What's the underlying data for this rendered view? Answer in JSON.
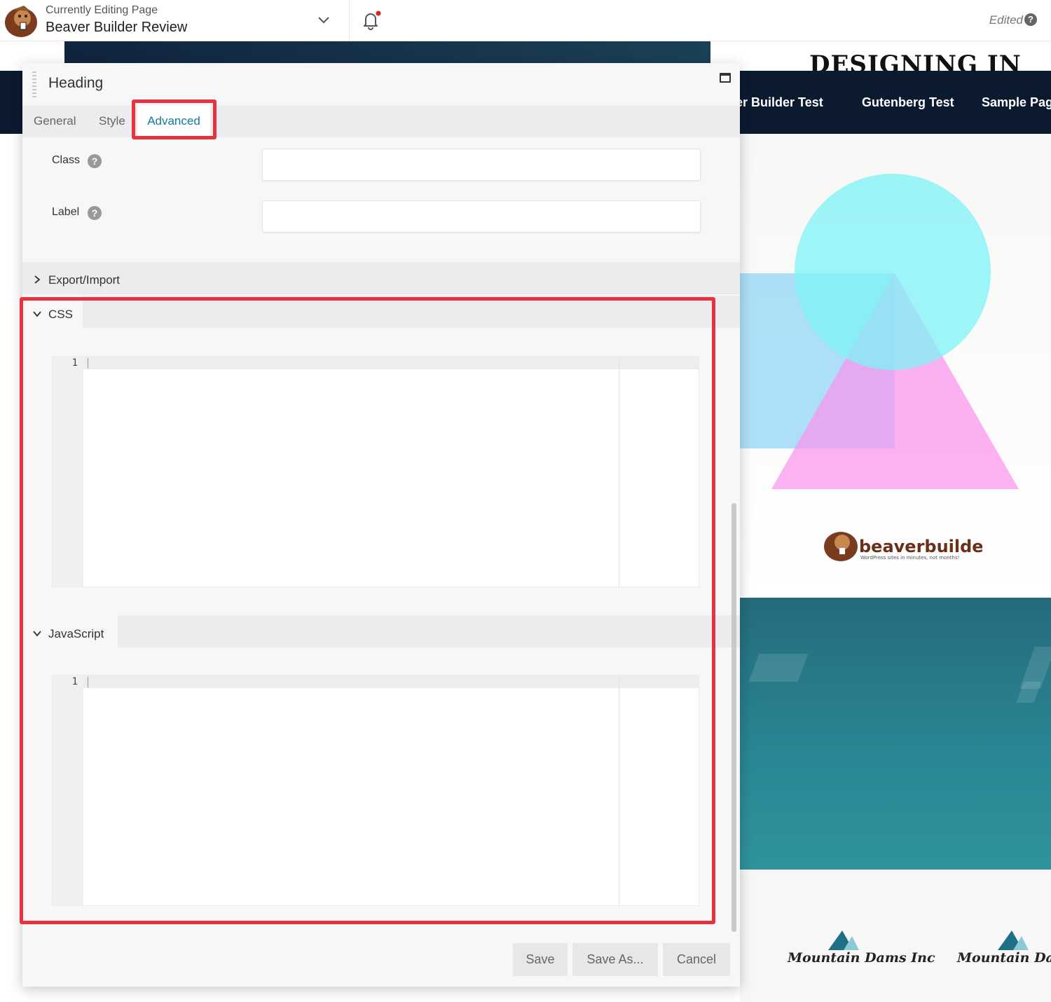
{
  "topbar": {
    "editing_label": "Currently Editing Page",
    "page_name": "Beaver Builder Review",
    "status": "Edited",
    "help_glyph": "?"
  },
  "preview": {
    "hero_title": "DESIGNING IN",
    "nav": [
      "ver Builder Test",
      "Gutenberg Test",
      "Sample Pag"
    ],
    "brand_logo_text": "beaverbuilder",
    "brand_tagline": "WordPress sites in minutes, not months!",
    "client_logos": [
      "Mountain Dams Inc",
      "Mountain Dams"
    ]
  },
  "panel": {
    "title": "Heading",
    "tabs": {
      "general": "General",
      "style": "Style",
      "advanced": "Advanced"
    },
    "fields": {
      "class_label": "Class",
      "class_value": "",
      "label_label": "Label",
      "label_value": "",
      "help_glyph": "?"
    },
    "sections": {
      "export_import": "Export/Import",
      "css": "CSS",
      "javascript": "JavaScript"
    },
    "editors": {
      "css_line": "1",
      "js_line": "1"
    },
    "buttons": {
      "save": "Save",
      "save_as": "Save As...",
      "cancel": "Cancel"
    }
  },
  "colors": {
    "accent": "#0e7aa0",
    "highlight": "#e8323f",
    "nav_bg": "#0c1a30",
    "teal": "#2a8795",
    "notification_dot": "#e2221b"
  },
  "icons": [
    "beaver-logo-icon",
    "chevron-down-icon",
    "bell-icon",
    "help-icon",
    "drag-handle-icon",
    "maximize-icon",
    "chevron-right-icon"
  ]
}
